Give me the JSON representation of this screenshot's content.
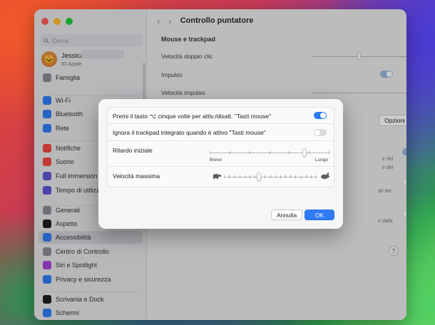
{
  "window": {
    "title": "Controllo puntatore"
  },
  "sidebar": {
    "search_placeholder": "Cerca",
    "user": {
      "name": "Jessica",
      "subtitle": "ID Apple"
    },
    "items": [
      {
        "label": "Famiglia",
        "icon": "family-icon",
        "color": "#8e8e93"
      },
      {
        "label": "Wi-Fi",
        "icon": "wifi-icon",
        "color": "#2f7cf6"
      },
      {
        "label": "Bluetooth",
        "icon": "bluetooth-icon",
        "color": "#2f7cf6"
      },
      {
        "label": "Rete",
        "icon": "globe-icon",
        "color": "#2f7cf6"
      },
      {
        "label": "Notifiche",
        "icon": "bell-icon",
        "color": "#f04a42"
      },
      {
        "label": "Suono",
        "icon": "speaker-icon",
        "color": "#f04a42"
      },
      {
        "label": "Full immersion",
        "icon": "moon-icon",
        "color": "#5e56d6"
      },
      {
        "label": "Tempo di utilizzo",
        "icon": "hourglass-icon",
        "color": "#5e56d6"
      },
      {
        "label": "Generali",
        "icon": "gear-icon",
        "color": "#8e8e93"
      },
      {
        "label": "Aspetto",
        "icon": "appearance-icon",
        "color": "#1f1f1f"
      },
      {
        "label": "Accessibilità",
        "icon": "accessibility-icon",
        "color": "#2f7cf6"
      },
      {
        "label": "Centro di Controllo",
        "icon": "control-center-icon",
        "color": "#8e8e93"
      },
      {
        "label": "Siri e Spotlight",
        "icon": "siri-icon",
        "color": "#a445d8"
      },
      {
        "label": "Privacy e sicurezza",
        "icon": "hand-icon",
        "color": "#2f7cf6"
      },
      {
        "label": "Scrivania e Dock",
        "icon": "dock-icon",
        "color": "#1f1f1f"
      },
      {
        "label": "Schermi",
        "icon": "display-icon",
        "color": "#2f7cf6"
      }
    ]
  },
  "main": {
    "section_title": "Mouse e trackpad",
    "rows": [
      {
        "label": "Velocità doppio clic"
      },
      {
        "label": "Impulso"
      },
      {
        "label": "Velocità impulso"
      }
    ],
    "options_button": "Opzioni mouse...",
    "help_label": "?",
    "partial_texts": [
      "e del",
      "e del",
      "ati del",
      "e dalla"
    ]
  },
  "sheet": {
    "toggle_mouse_keys": {
      "label": "Premi il tasto ⌥ cinque volte per attiv./disatt. \"Tasti mouse\"",
      "on": true
    },
    "ignore_trackpad": {
      "label": "Ignora il trackpad integrato quando è attivo \"Tasti mouse\"",
      "on": false
    },
    "initial_delay": {
      "label": "Ritardo iniziale",
      "min_label": "Breve",
      "max_label": "Lungo",
      "value": 0.8
    },
    "max_speed": {
      "label": "Velocità massima",
      "value": 0.37
    },
    "cancel_label": "Annulla",
    "ok_label": "OK"
  }
}
